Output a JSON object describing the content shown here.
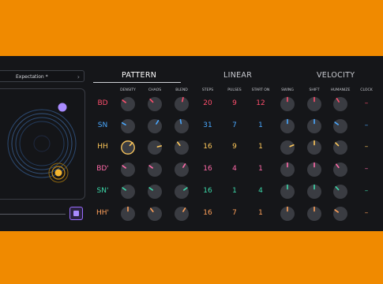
{
  "preset": {
    "value": "Expectation *",
    "chevron": "›"
  },
  "tabs": [
    {
      "label": "PATTERN",
      "active": true
    },
    {
      "label": "LINEAR",
      "active": false
    },
    {
      "label": "VELOCITY",
      "active": false
    }
  ],
  "columns": {
    "density": "DENSITY",
    "chaos": "CHAOS",
    "blend": "BLEND",
    "steps": "STEPS",
    "pulses": "PULSES",
    "start_on": "START ON",
    "swing": "SWING",
    "shift": "SHIFT",
    "humanize": "HUMANIZE",
    "clock": "CLOCK"
  },
  "rows": [
    {
      "label": "BD",
      "color": "#ff4f6d",
      "steps": "20",
      "pulses": "9",
      "start_on": "12",
      "clock": "–",
      "knobs": {
        "density": 0.3,
        "chaos": 0.34,
        "blend": 0.55,
        "swing": 0.5,
        "shift": 0.5,
        "humanize": 0.38
      }
    },
    {
      "label": "SN",
      "color": "#4aa8ff",
      "steps": "31",
      "pulses": "7",
      "start_on": "1",
      "clock": "–",
      "knobs": {
        "density": 0.28,
        "chaos": 0.62,
        "blend": 0.46,
        "swing": 0.5,
        "shift": 0.5,
        "humanize": 0.3
      }
    },
    {
      "label": "HH",
      "color": "#ffc85a",
      "steps": "16",
      "pulses": "9",
      "start_on": "1",
      "clock": "–",
      "knobs": {
        "density": 0.66,
        "chaos": 0.78,
        "blend": 0.36,
        "swing": 0.75,
        "shift": 0.5,
        "humanize": 0.33
      }
    },
    {
      "label": "BD'",
      "color": "#ff6aa8",
      "steps": "16",
      "pulses": "4",
      "start_on": "1",
      "clock": "–",
      "knobs": {
        "density": 0.3,
        "chaos": 0.3,
        "blend": 0.62,
        "swing": 0.5,
        "shift": 0.5,
        "humanize": 0.36
      }
    },
    {
      "label": "SN'",
      "color": "#3dd9a9",
      "steps": "16",
      "pulses": "1",
      "start_on": "4",
      "clock": "–",
      "knobs": {
        "density": 0.3,
        "chaos": 0.3,
        "blend": 0.7,
        "swing": 0.5,
        "shift": 0.5,
        "humanize": 0.34
      }
    },
    {
      "label": "HH'",
      "color": "#ffa05a",
      "steps": "16",
      "pulses": "7",
      "start_on": "1",
      "clock": "–",
      "knobs": {
        "density": 0.5,
        "chaos": 0.36,
        "blend": 0.62,
        "swing": 0.5,
        "shift": 0.5,
        "humanize": 0.3
      }
    }
  ],
  "colors": {
    "accent": "#a98bff",
    "panel": "#151619",
    "frame": "#F08A00"
  }
}
